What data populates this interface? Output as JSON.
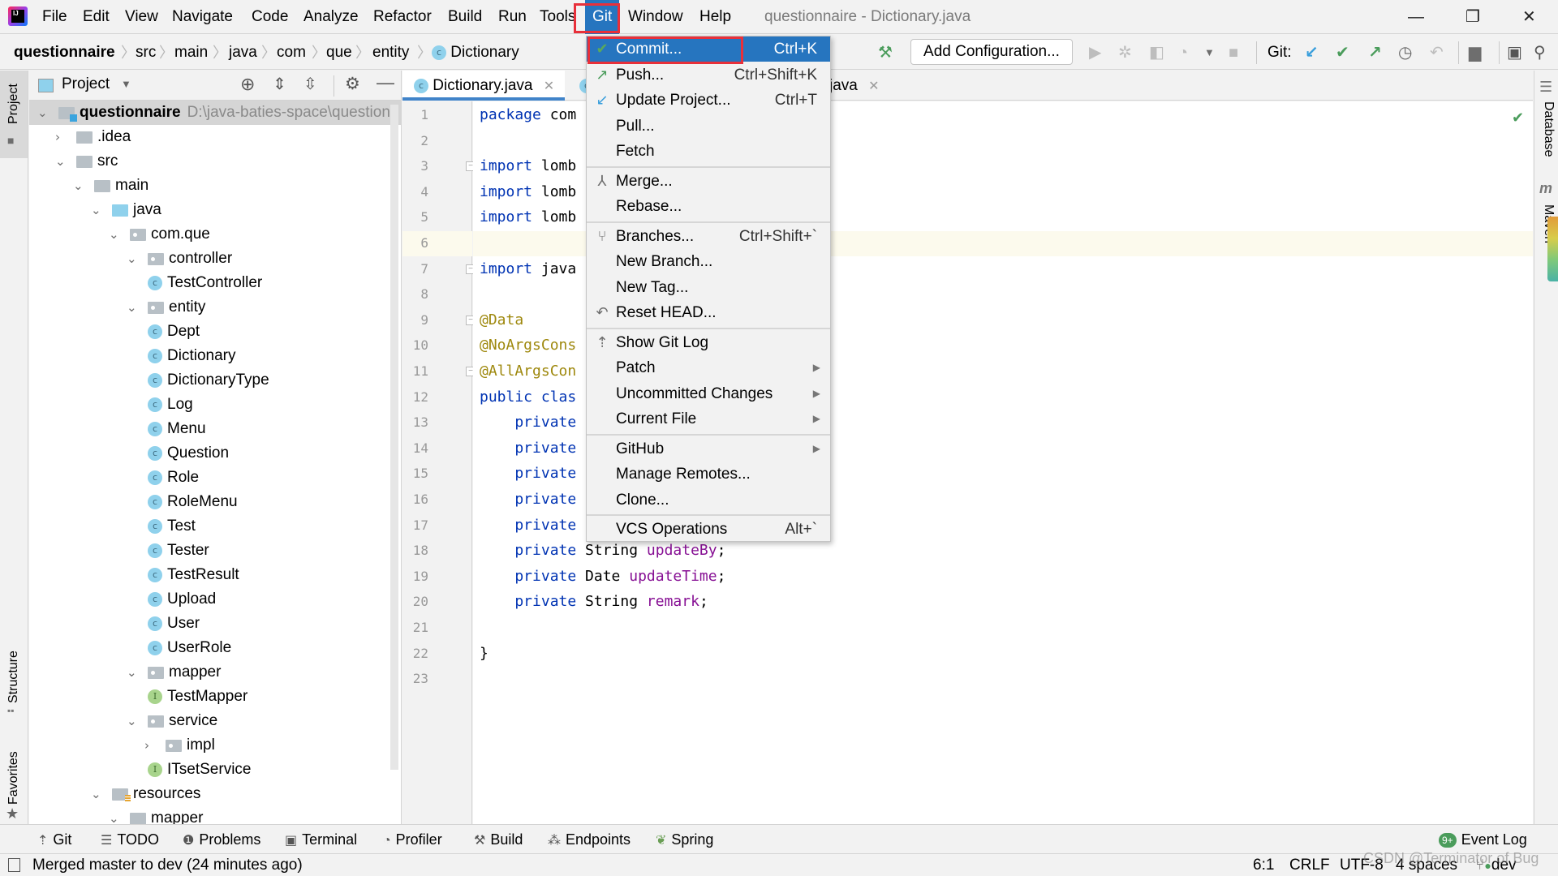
{
  "menubar": {
    "items": [
      "File",
      "Edit",
      "View",
      "Navigate",
      "Code",
      "Analyze",
      "Refactor",
      "Build",
      "Run",
      "Tools",
      "Git",
      "Window",
      "Help"
    ],
    "active_item": "Git",
    "window_title": "questionnaire - Dictionary.java",
    "controls": {
      "minimize": "—",
      "restore": "❐",
      "close": "✕"
    }
  },
  "breadcrumb": [
    "questionnaire",
    "src",
    "main",
    "java",
    "com",
    "que",
    "entity",
    "Dictionary"
  ],
  "toolbar": {
    "add_configuration": "Add Configuration...",
    "git_label": "Git:",
    "icons": [
      "build-hammer-icon",
      "run-icon",
      "debug-icon",
      "coverage-icon",
      "profile-icon",
      "stop-icon",
      "git-update-icon",
      "git-commit-icon",
      "git-push-icon",
      "history-icon",
      "rollback-icon",
      "project-structure-icon",
      "run-anything-icon",
      "search-icon"
    ]
  },
  "project_panel": {
    "title": "Project",
    "tree": [
      {
        "label": "questionnaire",
        "path": "D:\\java-baties-space\\questionn",
        "level": 0,
        "kind": "module",
        "expanded": true,
        "selected": true
      },
      {
        "label": ".idea",
        "level": 1,
        "kind": "folder",
        "expanded": false
      },
      {
        "label": "src",
        "level": 1,
        "kind": "folder",
        "expanded": true
      },
      {
        "label": "main",
        "level": 2,
        "kind": "folder",
        "expanded": true
      },
      {
        "label": "java",
        "level": 3,
        "kind": "src",
        "expanded": true
      },
      {
        "label": "com.que",
        "level": 4,
        "kind": "package",
        "expanded": true
      },
      {
        "label": "controller",
        "level": 5,
        "kind": "package",
        "expanded": true
      },
      {
        "label": "TestController",
        "level": 6,
        "kind": "class"
      },
      {
        "label": "entity",
        "level": 5,
        "kind": "package",
        "expanded": true
      },
      {
        "label": "Dept",
        "level": 6,
        "kind": "class"
      },
      {
        "label": "Dictionary",
        "level": 6,
        "kind": "class"
      },
      {
        "label": "DictionaryType",
        "level": 6,
        "kind": "class"
      },
      {
        "label": "Log",
        "level": 6,
        "kind": "class"
      },
      {
        "label": "Menu",
        "level": 6,
        "kind": "class"
      },
      {
        "label": "Question",
        "level": 6,
        "kind": "class"
      },
      {
        "label": "Role",
        "level": 6,
        "kind": "class"
      },
      {
        "label": "RoleMenu",
        "level": 6,
        "kind": "class"
      },
      {
        "label": "Test",
        "level": 6,
        "kind": "class"
      },
      {
        "label": "Tester",
        "level": 6,
        "kind": "class"
      },
      {
        "label": "TestResult",
        "level": 6,
        "kind": "class"
      },
      {
        "label": "Upload",
        "level": 6,
        "kind": "class"
      },
      {
        "label": "User",
        "level": 6,
        "kind": "class"
      },
      {
        "label": "UserRole",
        "level": 6,
        "kind": "class"
      },
      {
        "label": "mapper",
        "level": 5,
        "kind": "package",
        "expanded": true
      },
      {
        "label": "TestMapper",
        "level": 6,
        "kind": "interface"
      },
      {
        "label": "service",
        "level": 5,
        "kind": "package",
        "expanded": true
      },
      {
        "label": "impl",
        "level": 6,
        "kind": "package",
        "expanded": false
      },
      {
        "label": "ITsetService",
        "level": 6,
        "kind": "interface"
      },
      {
        "label": "resources",
        "level": 3,
        "kind": "resources",
        "expanded": true
      },
      {
        "label": "mapper",
        "level": 4,
        "kind": "folder",
        "expanded": true
      }
    ]
  },
  "left_stripe": [
    "Project",
    "Structure",
    "Favorites"
  ],
  "right_stripe": [
    "Database",
    "Maven"
  ],
  "editor": {
    "tabs": [
      {
        "label": "Dictionary.java",
        "active": true
      },
      {
        "label": "...java",
        "active": false
      }
    ],
    "hidden_tab_tail": "java",
    "current_line": 6,
    "lines": [
      [
        {
          "t": "package ",
          "c": "kw"
        },
        {
          "t": "com"
        }
      ],
      [],
      [
        {
          "t": "import ",
          "c": "kw"
        },
        {
          "t": "lomb"
        }
      ],
      [
        {
          "t": "import ",
          "c": "kw"
        },
        {
          "t": "lomb"
        }
      ],
      [
        {
          "t": "import ",
          "c": "kw"
        },
        {
          "t": "lomb"
        }
      ],
      [],
      [
        {
          "t": "import ",
          "c": "kw"
        },
        {
          "t": "java"
        }
      ],
      [],
      [
        {
          "t": "@Data",
          "c": "ann"
        }
      ],
      [
        {
          "t": "@NoArgsCons",
          "c": "ann"
        }
      ],
      [
        {
          "t": "@AllArgsCon",
          "c": "ann"
        }
      ],
      [
        {
          "t": "public clas",
          "c": "kw"
        }
      ],
      [
        {
          "t": "    private",
          "c": "kw"
        }
      ],
      [
        {
          "t": "    private",
          "c": "kw"
        }
      ],
      [
        {
          "t": "    private",
          "c": "kw"
        }
      ],
      [
        {
          "t": "    private",
          "c": "kw"
        }
      ],
      [
        {
          "t": "    private",
          "c": "kw"
        }
      ],
      [
        {
          "t": "    private ",
          "c": "kw"
        },
        {
          "t": "String "
        },
        {
          "t": "updateBy",
          "c": "fld"
        },
        {
          "t": ";"
        }
      ],
      [
        {
          "t": "    private ",
          "c": "kw"
        },
        {
          "t": "Date "
        },
        {
          "t": "updateTime",
          "c": "fld"
        },
        {
          "t": ";"
        }
      ],
      [
        {
          "t": "    private ",
          "c": "kw"
        },
        {
          "t": "String "
        },
        {
          "t": "remark",
          "c": "fld"
        },
        {
          "t": ";"
        }
      ],
      [],
      [
        {
          "t": "}"
        }
      ],
      []
    ]
  },
  "git_menu": {
    "items": [
      {
        "label": "Commit...",
        "shortcut": "Ctrl+K",
        "icon": "commit-check-icon",
        "active": true
      },
      {
        "label": "Push...",
        "shortcut": "Ctrl+Shift+K",
        "icon": "push-arrow-icon"
      },
      {
        "label": "Update Project...",
        "shortcut": "Ctrl+T",
        "icon": "update-arrow-icon"
      },
      {
        "label": "Pull...",
        "shortcut": ""
      },
      {
        "label": "Fetch",
        "shortcut": "",
        "separator_after": true
      },
      {
        "label": "Merge...",
        "shortcut": "",
        "icon": "merge-icon"
      },
      {
        "label": "Rebase...",
        "shortcut": "",
        "separator_after": true
      },
      {
        "label": "Branches...",
        "shortcut": "Ctrl+Shift+`",
        "icon": "branch-icon"
      },
      {
        "label": "New Branch...",
        "shortcut": ""
      },
      {
        "label": "New Tag...",
        "shortcut": ""
      },
      {
        "label": "Reset HEAD...",
        "shortcut": "",
        "icon": "reset-icon",
        "separator_after": true
      },
      {
        "label": "Show Git Log",
        "shortcut": "",
        "icon": "git-log-icon"
      },
      {
        "label": "Patch",
        "shortcut": "",
        "submenu": true
      },
      {
        "label": "Uncommitted Changes",
        "shortcut": "",
        "submenu": true
      },
      {
        "label": "Current File",
        "shortcut": "",
        "submenu": true,
        "separator_after": true
      },
      {
        "label": "GitHub",
        "shortcut": "",
        "submenu": true
      },
      {
        "label": "Manage Remotes...",
        "shortcut": ""
      },
      {
        "label": "Clone...",
        "shortcut": "",
        "separator_after": true
      },
      {
        "label": "VCS Operations",
        "shortcut": "Alt+`"
      }
    ]
  },
  "bottom_tools": [
    {
      "label": "Git",
      "icon": "git-icon"
    },
    {
      "label": "TODO",
      "icon": "todo-list-icon"
    },
    {
      "label": "Problems",
      "icon": "problems-icon"
    },
    {
      "label": "Terminal",
      "icon": "terminal-icon"
    },
    {
      "label": "Profiler",
      "icon": "profiler-icon"
    },
    {
      "label": "Build",
      "icon": "build-icon"
    },
    {
      "label": "Endpoints",
      "icon": "endpoints-icon"
    },
    {
      "label": "Spring",
      "icon": "spring-leaf-icon"
    }
  ],
  "event_log": {
    "label": "Event Log",
    "badge": "9+"
  },
  "statusbar": {
    "message": "Merged master to dev (24 minutes ago)",
    "position": "6:1",
    "line_separator": "CRLF",
    "encoding": "UTF-8",
    "indent": "4 spaces",
    "branch": "dev"
  },
  "watermark": "CSDN @Terminator of Bug",
  "colors": {
    "accent": "#2675bf",
    "highlight_box": "#e8303a",
    "keyword": "#0033b3",
    "annotation": "#9e880d",
    "field": "#871094"
  }
}
